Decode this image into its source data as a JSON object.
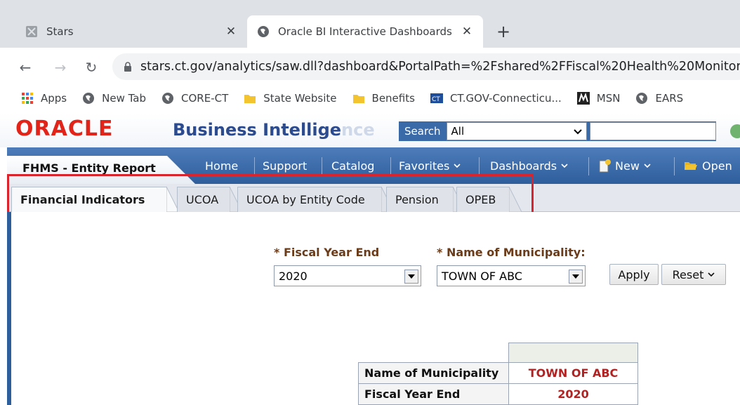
{
  "browser": {
    "tabs": [
      {
        "title": "Stars",
        "close": "✕"
      },
      {
        "title": "Oracle BI Interactive Dashboards",
        "close": "✕"
      }
    ],
    "new_tab": "+",
    "url": "stars.ct.gov/analytics/saw.dll?dashboard&PortalPath=%2Fshared%2FFiscal%20Health%20Monitorin",
    "bookmarks": [
      {
        "label": "Apps",
        "icon": "apps-grid-icon"
      },
      {
        "label": "New Tab",
        "icon": "globe-icon"
      },
      {
        "label": "CORE-CT",
        "icon": "globe-icon"
      },
      {
        "label": "State Website",
        "icon": "folder-icon"
      },
      {
        "label": "Benefits",
        "icon": "folder-icon"
      },
      {
        "label": "CT.GOV-Connecticu...",
        "icon": "ct-gov-icon"
      },
      {
        "label": "MSN",
        "icon": "msn-icon"
      },
      {
        "label": "EARS",
        "icon": "globe-icon"
      }
    ]
  },
  "obi": {
    "logo": "ORACLE",
    "title_main": "Business Intellige",
    "title_fade": "nce",
    "search_label": "Search",
    "search_scope": "All",
    "dashboard_name": "FHMS - Entity Report",
    "menu": [
      "Home",
      "Support",
      "Catalog",
      "Favorites",
      "Dashboards",
      "New",
      "Open"
    ],
    "page_tabs": [
      "Financial Indicators",
      "UCOA",
      "UCOA by Entity Code",
      "Pension",
      "OPEB"
    ],
    "active_tab": "Financial Indicators"
  },
  "prompts": {
    "fiscal_year_label": "* Fiscal Year End",
    "fiscal_year_value": "2020",
    "municipality_label": "* Name of Municipality:",
    "municipality_value": "TOWN OF ABC",
    "apply": "Apply",
    "reset": "Reset"
  },
  "report": {
    "rows": [
      {
        "label": "Name of Municipality",
        "value": "TOWN OF ABC"
      },
      {
        "label": "Fiscal Year End",
        "value": "2020"
      }
    ]
  },
  "colors": {
    "oracle_red": "#e2231a",
    "bi_blue": "#2c4a8e",
    "nav_blue": "#2f5e9c",
    "highlight_red": "#d9232d",
    "value_red": "#b22222",
    "prompt_brown": "#6b3c1a"
  }
}
